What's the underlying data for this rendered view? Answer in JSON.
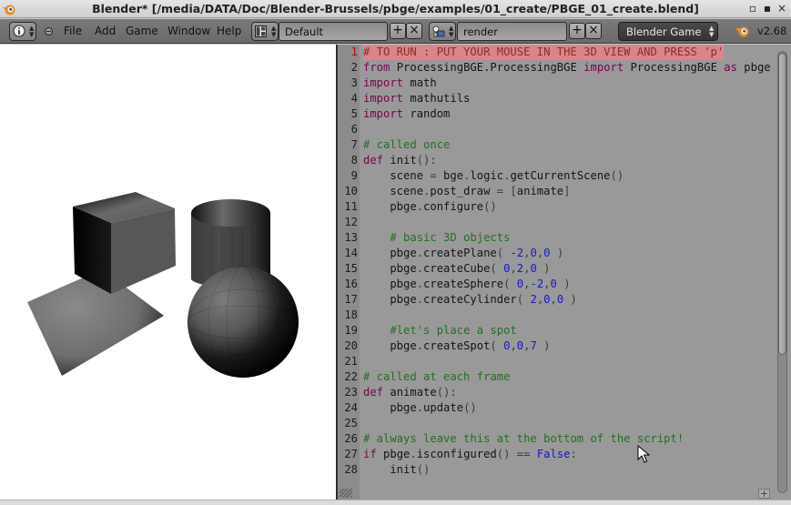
{
  "window": {
    "title": "Blender* [/media/DATA/Doc/Blender-Brussels/pbge/examples/01_create/PBGE_01_create.blend]",
    "minimize_glyph": "▫",
    "maximize_glyph": "▪",
    "close_glyph": "×"
  },
  "header": {
    "menus": [
      "File",
      "Add",
      "Game",
      "Window",
      "Help"
    ],
    "screen_layout": "Default",
    "scene": "render",
    "engine": "Blender Game",
    "version": "v2.68"
  },
  "editor": {
    "current_line": 1,
    "lines": [
      {
        "n": "1",
        "html": "<span class=\"cmt\"># TO RUN : PUT YOUR MOUSE IN THE 3D VIEW AND PRESS 'p'</span>"
      },
      {
        "n": "2",
        "html": "<span class=\"kw\">from</span> ProcessingBGE.ProcessingBGE <span class=\"kw\">import</span> ProcessingBGE <span class=\"kw\">as</span> pbge"
      },
      {
        "n": "3",
        "html": "<span class=\"kw\">import</span> math"
      },
      {
        "n": "4",
        "html": "<span class=\"kw\">import</span> mathutils"
      },
      {
        "n": "5",
        "html": "<span class=\"kw\">import</span> random"
      },
      {
        "n": "6",
        "html": ""
      },
      {
        "n": "7",
        "html": "<span class=\"cmt\"># called once</span>"
      },
      {
        "n": "8",
        "html": "<span class=\"kw\">def</span> init<span class=\"op\">():</span>"
      },
      {
        "n": "9",
        "html": "    scene <span class=\"op\">=</span> bge<span class=\"op\">.</span>logic<span class=\"op\">.</span>getCurrentScene<span class=\"op\">()</span>"
      },
      {
        "n": "10",
        "html": "    scene<span class=\"op\">.</span>post_draw <span class=\"op\">= [</span>animate<span class=\"op\">]</span>"
      },
      {
        "n": "11",
        "html": "    pbge<span class=\"op\">.</span>configure<span class=\"op\">()</span>"
      },
      {
        "n": "12",
        "html": ""
      },
      {
        "n": "13",
        "html": "    <span class=\"cmt\"># basic 3D objects</span>"
      },
      {
        "n": "14",
        "html": "    pbge<span class=\"op\">.</span>createPlane<span class=\"op\">( </span><span class=\"num\">-2</span><span class=\"op\">,</span><span class=\"num\">0</span><span class=\"op\">,</span><span class=\"num\">0</span><span class=\"op\"> )</span>"
      },
      {
        "n": "15",
        "html": "    pbge<span class=\"op\">.</span>createCube<span class=\"op\">( </span><span class=\"num\">0</span><span class=\"op\">,</span><span class=\"num\">2</span><span class=\"op\">,</span><span class=\"num\">0</span><span class=\"op\"> )</span>"
      },
      {
        "n": "16",
        "html": "    pbge<span class=\"op\">.</span>createSphere<span class=\"op\">( </span><span class=\"num\">0</span><span class=\"op\">,</span><span class=\"num\">-2</span><span class=\"op\">,</span><span class=\"num\">0</span><span class=\"op\"> )</span>"
      },
      {
        "n": "17",
        "html": "    pbge<span class=\"op\">.</span>createCylinder<span class=\"op\">( </span><span class=\"num\">2</span><span class=\"op\">,</span><span class=\"num\">0</span><span class=\"op\">,</span><span class=\"num\">0</span><span class=\"op\"> )</span>"
      },
      {
        "n": "18",
        "html": ""
      },
      {
        "n": "19",
        "html": "    <span class=\"cmt\">#let's place a spot</span>"
      },
      {
        "n": "20",
        "html": "    pbge<span class=\"op\">.</span>createSpot<span class=\"op\">( </span><span class=\"num\">0</span><span class=\"op\">,</span><span class=\"num\">0</span><span class=\"op\">,</span><span class=\"num\">7</span><span class=\"op\"> )</span>"
      },
      {
        "n": "21",
        "html": ""
      },
      {
        "n": "22",
        "html": "<span class=\"cmt\"># called at each frame</span>"
      },
      {
        "n": "23",
        "html": "<span class=\"kw\">def</span> animate<span class=\"op\">():</span>"
      },
      {
        "n": "24",
        "html": "    pbge<span class=\"op\">.</span>update<span class=\"op\">()</span>"
      },
      {
        "n": "25",
        "html": ""
      },
      {
        "n": "26",
        "html": "<span class=\"cmt\"># always leave this at the bottom of the script!</span>"
      },
      {
        "n": "27",
        "html": "<span class=\"kw\">if</span> pbge<span class=\"op\">.</span>isconfigured<span class=\"op\">() ==</span> <span class=\"bool\">False</span><span class=\"op\">:</span>"
      },
      {
        "n": "28",
        "html": "    init<span class=\"op\">()</span>"
      }
    ]
  },
  "icons": {
    "app": "blender-logo-icon",
    "info": "info-editor-icon",
    "layout": "screen-layout-icon",
    "scene": "scene-icon",
    "engine": "blender-logo-icon"
  }
}
